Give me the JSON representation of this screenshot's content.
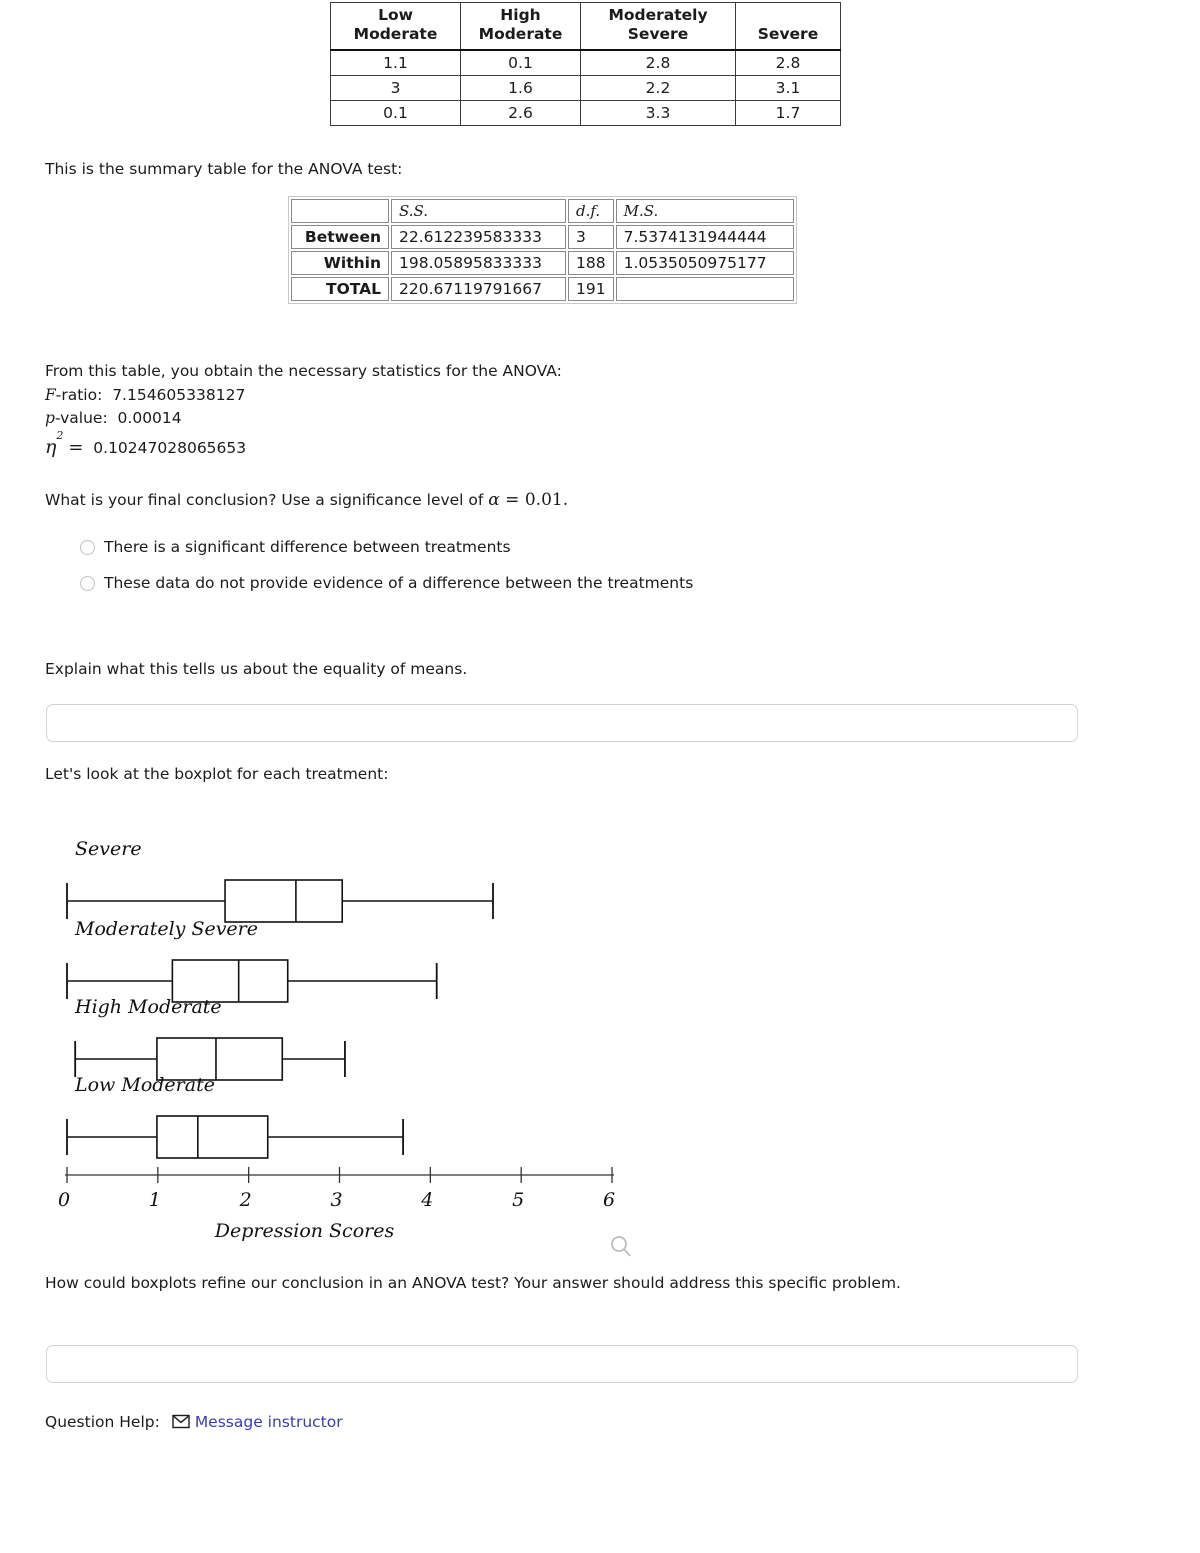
{
  "data_table": {
    "headers": [
      "Low Moderate",
      "High Moderate",
      "Moderately Severe",
      "Severe"
    ],
    "header_lines": [
      [
        "Low",
        "Moderate"
      ],
      [
        "High",
        "Moderate"
      ],
      [
        "Moderately",
        "Severe"
      ],
      [
        "",
        "Severe"
      ]
    ],
    "rows": [
      [
        "1.1",
        "0.1",
        "2.8",
        "2.8"
      ],
      [
        "3",
        "1.6",
        "2.2",
        "3.1"
      ],
      [
        "0.1",
        "2.6",
        "3.3",
        "1.7"
      ]
    ]
  },
  "summary_intro": "This is the summary table for the ANOVA test:",
  "anova_table": {
    "headers": [
      "",
      "S.S.",
      "d.f.",
      "M.S."
    ],
    "rows": [
      {
        "label": "Between",
        "ss": "22.612239583333",
        "df": "3",
        "ms": "7.5374131944444"
      },
      {
        "label": "Within",
        "ss": "198.05895833333",
        "df": "188",
        "ms": "1.0535050975177"
      },
      {
        "label": "TOTAL",
        "ss": "220.67119791667",
        "df": "191",
        "ms": ""
      }
    ]
  },
  "stats": {
    "intro": "From this table, you obtain the necessary statistics for the ANOVA:",
    "f_label": "F",
    "f_rest": "-ratio:",
    "f_value": "7.154605338127",
    "p_label": "p",
    "p_rest": "-value:",
    "p_value": "0.00014",
    "eta_symbol": "η",
    "eta_exponent": "2",
    "eta_equals": "=",
    "eta_value": "0.10247028065653"
  },
  "conclusion_question": {
    "text_before": "What is your final conclusion?  Use a significance level of ",
    "alpha_symbol": "α",
    "equals": " = ",
    "alpha_value": "0.01."
  },
  "options": [
    {
      "label": "There is a significant difference between treatments",
      "selected": false
    },
    {
      "label": "These data do not provide evidence of a difference between the treatments",
      "selected": false
    }
  ],
  "prompts": {
    "equality": "Explain what this tells us about the equality of means.",
    "boxplot_intro": "Let's look at the boxplot for each treatment:",
    "refine": "How could boxplots refine our conclusion in an ANOVA test? Your answer should address this specific problem."
  },
  "answers": {
    "equality_value": "",
    "refine_value": ""
  },
  "footer": {
    "help_label": "Question Help:",
    "message_link": "Message instructor",
    "envelope_icon": "envelope-icon",
    "link_color": "#3b3bb0"
  },
  "zoom_icon_name": "magnifier-icon",
  "chart_data": {
    "type": "boxplot",
    "title": "",
    "xlabel": "Depression Scores",
    "ylabel": "",
    "xlim": [
      0,
      6
    ],
    "xticks": [
      0,
      1,
      2,
      3,
      4,
      5,
      6
    ],
    "xtick_labels": [
      "0",
      "1",
      "2",
      "3",
      "4",
      "5",
      "6"
    ],
    "grid": false,
    "legend": "none",
    "orientation": "horizontal",
    "boxes": [
      {
        "name": "Severe",
        "min": 0.0,
        "q1": 1.74,
        "median": 2.52,
        "q3": 3.03,
        "max": 4.69
      },
      {
        "name": "Moderately Severe",
        "min": 0.0,
        "q1": 1.16,
        "median": 1.89,
        "q3": 2.43,
        "max": 4.07
      },
      {
        "name": "High Moderate",
        "min": 0.09,
        "q1": 0.99,
        "median": 1.64,
        "q3": 2.37,
        "max": 3.06
      },
      {
        "name": "Low Moderate",
        "min": 0.0,
        "q1": 0.99,
        "median": 1.44,
        "q3": 2.21,
        "max": 3.7
      }
    ]
  }
}
